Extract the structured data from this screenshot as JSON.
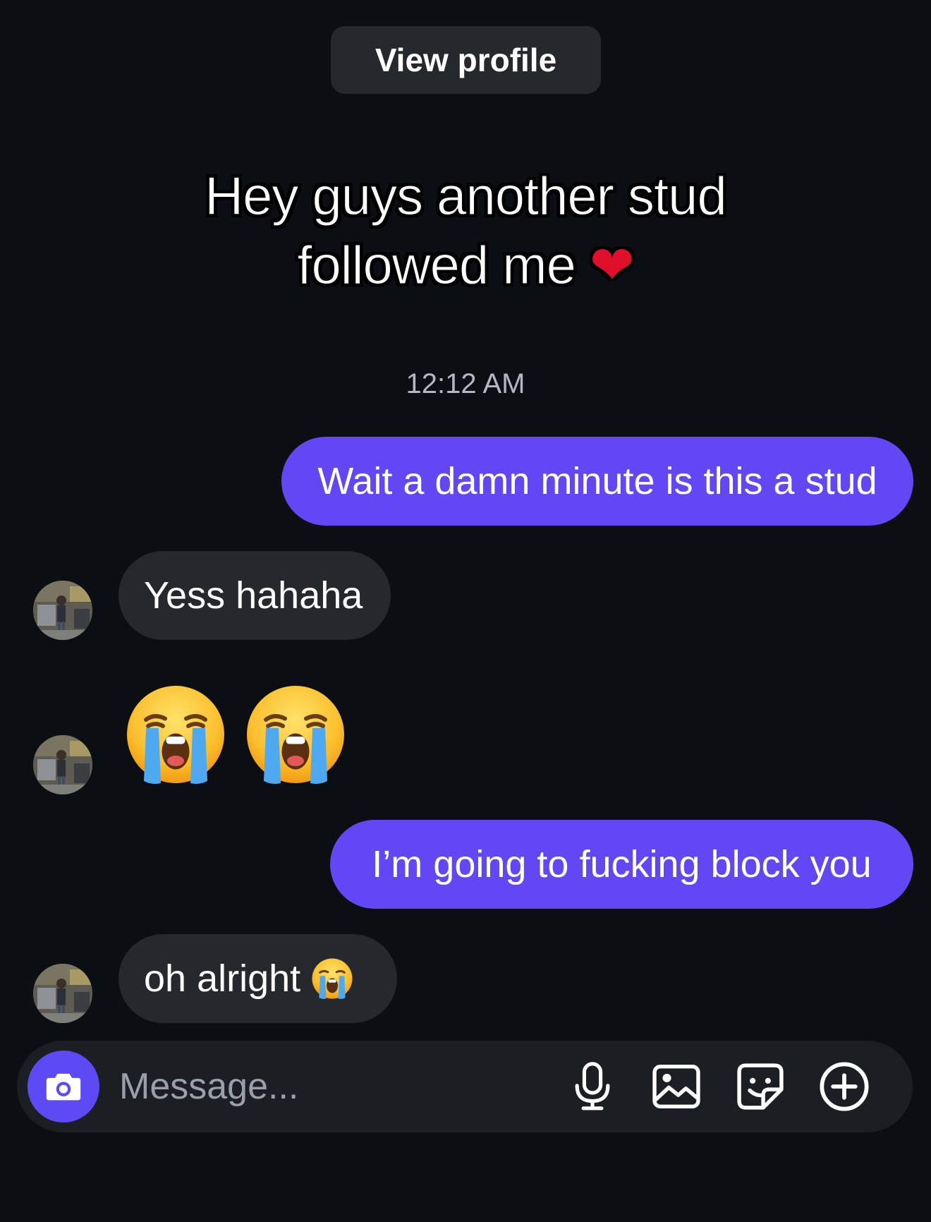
{
  "header": {
    "view_profile_label": "View profile"
  },
  "caption": {
    "line1": "Hey guys another stud",
    "line2": "followed me",
    "heart": "❤"
  },
  "chat": {
    "timestamp": "12:12 AM",
    "messages": [
      {
        "from": "me",
        "text": "Wait a damn minute is this a stud"
      },
      {
        "from": "them",
        "text": "Yess hahaha"
      },
      {
        "from": "them",
        "type": "emoji",
        "emojis": [
          "loudly-crying-face",
          "loudly-crying-face"
        ]
      },
      {
        "from": "me",
        "text": "I’m going to fucking block you"
      },
      {
        "from": "them",
        "text": "oh alright",
        "trailing_emoji": "loudly-crying-face"
      }
    ]
  },
  "composer": {
    "placeholder": "Message...",
    "icons": [
      "camera-icon",
      "microphone-icon",
      "image-icon",
      "sticker-icon",
      "plus-circle-icon"
    ]
  },
  "colors": {
    "background": "#0b0e13",
    "outgoing_bubble": "#6347f5",
    "incoming_bubble": "#25282d",
    "camera_button": "#5d4af4"
  }
}
